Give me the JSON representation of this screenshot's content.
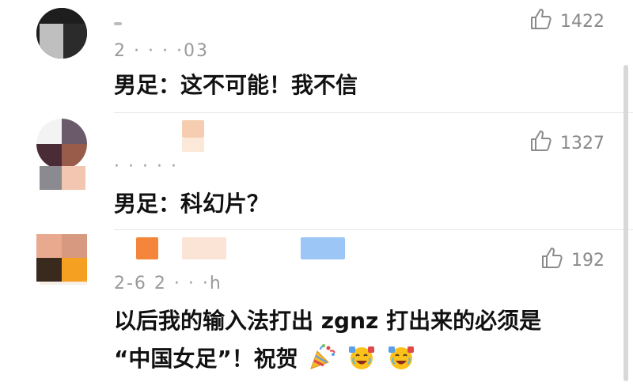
{
  "comments": [
    {
      "time": "2 · · · ·03",
      "likes": "1422",
      "text": "男足：这不可能！我不信"
    },
    {
      "time": "· · · · ·",
      "likes": "1327",
      "text": "男足：科幻片？"
    },
    {
      "time": "2-6 2 · · ·h",
      "likes": "192",
      "text_line1": "以后我的输入法打出 zgnz 打出来的必须是",
      "text_line2": "“中国女足”！祝贺"
    }
  ],
  "icons": {
    "like": "thumbs-up-icon",
    "party": "party-popper-emoji",
    "cheer": "cheering-face-emoji"
  },
  "colors": {
    "text": "#111111",
    "meta": "#9a9a9a",
    "divider": "#e6e6e6"
  }
}
